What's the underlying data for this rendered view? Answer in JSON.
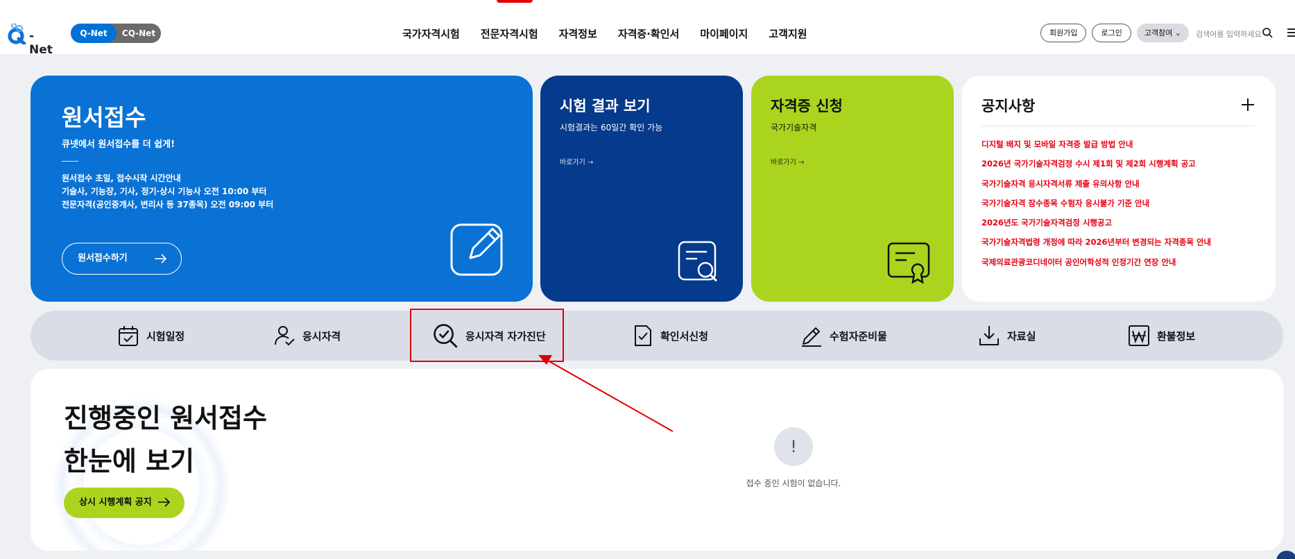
{
  "header": {
    "logo_text": "-Net",
    "site_switch": {
      "qnet": "Q-Net",
      "cqnet": "CQ-Net"
    },
    "gnb": [
      "국가자격시험",
      "전문자격시험",
      "자격정보",
      "자격증·확인서",
      "마이페이지",
      "고객지원"
    ],
    "util": {
      "signup": "회원가입",
      "login": "로그인",
      "lang": "고객참여"
    },
    "search_placeholder": "검색어를 입력하세요"
  },
  "cards": {
    "apply": {
      "title": "원서접수",
      "subtitle": "큐넷에서 원서접수를 더 쉽게!",
      "desc": [
        "원서접수 초일, 접수시작 시간안내",
        "기술사, 기능장, 기사, 정기·상시 기능사 오전 10:00 부터",
        "전문자격(공인중개사, 변리사 등 37종목) 오전 09:00 부터"
      ],
      "button": "원서접수하기"
    },
    "result": {
      "title": "시험 결과 보기",
      "subtitle": "시험결과는 60일간 확인 가능",
      "link": "바로가기 →"
    },
    "cert": {
      "title": "자격증 신청",
      "subtitle": "국가기술자격",
      "link": "바로가기 →"
    },
    "notice": {
      "title": "공지사항",
      "items": [
        "디지털 배지 및 모바일 자격증 발급 방법 안내",
        "2026년 국가기술자격검정 수시 제1회 및 제2회 시행계획 공고",
        "국가기술자격 응시자격서류 제출 유의사항 안내",
        "국가기술자격 잠수종목 수험자 응시불가 기준 안내",
        "2026년도 국가기술자격검정 시행공고",
        "국가기술자격법령 개정에 따라 2026년부터 변경되는 자격종목 안내",
        "국제의료관광코디네이터 공인어학성적 인정기간 연장 안내"
      ]
    }
  },
  "quick_menu": [
    {
      "label": "시험일정",
      "icon": "calendar-check-icon"
    },
    {
      "label": "응시자격",
      "icon": "person-check-icon"
    },
    {
      "label": "응시자격 자가진단",
      "icon": "magnifier-check-icon"
    },
    {
      "label": "확인서신청",
      "icon": "document-check-icon"
    },
    {
      "label": "수험자준비물",
      "icon": "pencil-icon"
    },
    {
      "label": "자료실",
      "icon": "download-icon"
    },
    {
      "label": "환불정보",
      "icon": "won-icon"
    }
  ],
  "ongoing": {
    "title_line1": "진행중인 원서접수",
    "title_line2": "한눈에 보기",
    "button": "상시 시행계획 공지",
    "empty_badge": "!",
    "empty_text": "접수 중인 시험이 없습니다."
  },
  "colors": {
    "apply_blue": "#0a72d4",
    "result_navy": "#053a8c",
    "cert_lime": "#abd41e",
    "notice_red": "#e60012",
    "annotation_red": "#e00000"
  }
}
